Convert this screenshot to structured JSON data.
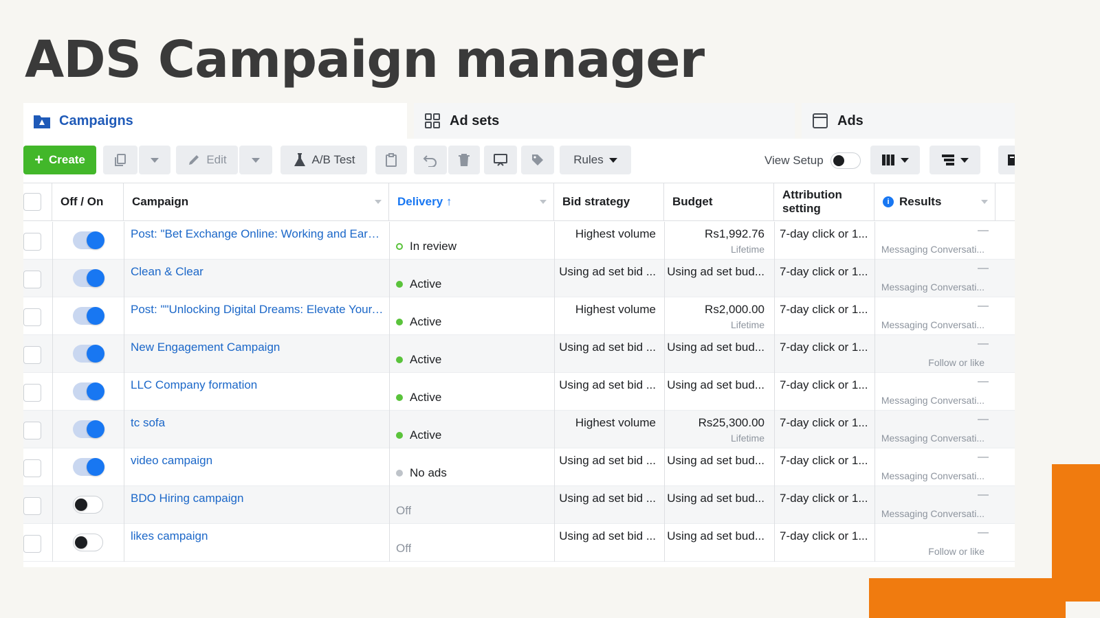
{
  "page_title": "ADS Campaign manager",
  "tabs": [
    {
      "label": "Campaigns",
      "icon": "folder-icon",
      "active": true
    },
    {
      "label": "Ad sets",
      "icon": "grid-icon",
      "active": false
    },
    {
      "label": "Ads",
      "icon": "ad-frame-icon",
      "active": false
    }
  ],
  "toolbar": {
    "create_label": "Create",
    "edit_label": "Edit",
    "ab_test_label": "A/B Test",
    "rules_label": "Rules",
    "view_setup_label": "View Setup"
  },
  "columns": {
    "offon": "Off / On",
    "campaign": "Campaign",
    "delivery": "Delivery ↑",
    "bid": "Bid strategy",
    "budget": "Budget",
    "attr_line1": "Attribution",
    "attr_line2": "setting",
    "results": "Results"
  },
  "rows": [
    {
      "on": true,
      "name": "Post: \"Bet Exchange Online: Working and Earni...",
      "delivery": "In review",
      "status": "review",
      "bid": "Highest volume",
      "budget": "Rs1,992.76",
      "budget_sub": "Lifetime",
      "attr": "7-day click or 1...",
      "result": "—",
      "result_sub": "Messaging Conversati..."
    },
    {
      "on": true,
      "name": "Clean & Clear",
      "delivery": "Active",
      "status": "active",
      "bid": "Using ad set bid ...",
      "budget": "Using ad set bud...",
      "budget_sub": "",
      "attr": "7-day click or 1...",
      "result": "—",
      "result_sub": "Messaging Conversati..."
    },
    {
      "on": true,
      "name": "Post: \"\"Unlocking Digital Dreams: Elevate Your...\"",
      "delivery": "Active",
      "status": "active",
      "bid": "Highest volume",
      "budget": "Rs2,000.00",
      "budget_sub": "Lifetime",
      "attr": "7-day click or 1...",
      "result": "—",
      "result_sub": "Messaging Conversati..."
    },
    {
      "on": true,
      "name": "New Engagement Campaign",
      "delivery": "Active",
      "status": "active",
      "bid": "Using ad set bid ...",
      "budget": "Using ad set bud...",
      "budget_sub": "",
      "attr": "7-day click or 1...",
      "result": "—",
      "result_sub": "Follow or like"
    },
    {
      "on": true,
      "name": "LLC Company formation",
      "delivery": "Active",
      "status": "active",
      "bid": "Using ad set bid ...",
      "budget": "Using ad set bud...",
      "budget_sub": "",
      "attr": "7-day click or 1...",
      "result": "—",
      "result_sub": "Messaging Conversati..."
    },
    {
      "on": true,
      "name": "tc sofa",
      "delivery": "Active",
      "status": "active",
      "bid": "Highest volume",
      "budget": "Rs25,300.00",
      "budget_sub": "Lifetime",
      "attr": "7-day click or 1...",
      "result": "—",
      "result_sub": "Messaging Conversati..."
    },
    {
      "on": true,
      "name": "video campaign",
      "delivery": "No ads",
      "status": "noads",
      "bid": "Using ad set bid ...",
      "budget": "Using ad set bud...",
      "budget_sub": "",
      "attr": "7-day click or 1...",
      "result": "—",
      "result_sub": "Messaging Conversati..."
    },
    {
      "on": false,
      "name": "BDO Hiring campaign",
      "delivery": "Off",
      "status": "off",
      "bid": "Using ad set bid ...",
      "budget": "Using ad set bud...",
      "budget_sub": "",
      "attr": "7-day click or 1...",
      "result": "—",
      "result_sub": "Messaging Conversati..."
    },
    {
      "on": false,
      "name": "likes campaign",
      "delivery": "Off",
      "status": "off",
      "bid": "Using ad set bid ...",
      "budget": "Using ad set bud...",
      "budget_sub": "",
      "attr": "7-day click or 1...",
      "result": "—",
      "result_sub": "Follow or like"
    }
  ],
  "colors": {
    "accent": "#1877f2",
    "create_green": "#42b72a",
    "active_green": "#5ac33b",
    "link_blue": "#1b67c8",
    "decor_orange": "#f07b0f"
  }
}
